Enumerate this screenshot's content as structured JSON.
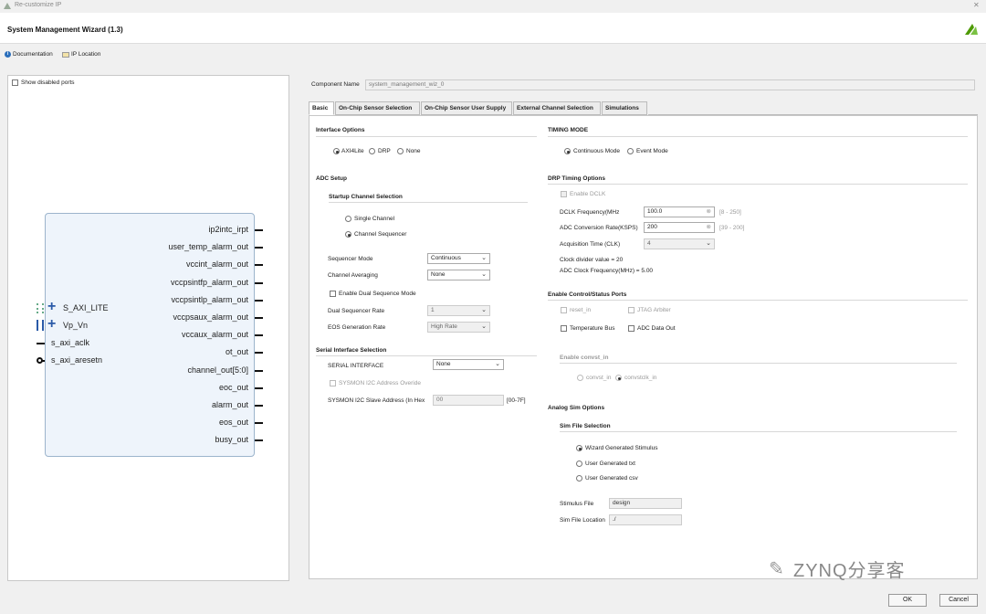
{
  "window": {
    "title": "Re-customize IP",
    "wizard_title": "System Management Wizard (1.3)"
  },
  "links": {
    "documentation": "Documentation",
    "ip_location": "IP Location"
  },
  "left": {
    "show_disabled": "Show disabled ports",
    "outputs": [
      "ip2intc_irpt",
      "user_temp_alarm_out",
      "vccint_alarm_out",
      "vccpsintfp_alarm_out",
      "vccpsintlp_alarm_out",
      "vccpsaux_alarm_out",
      "vccaux_alarm_out",
      "ot_out",
      "channel_out[5:0]",
      "eoc_out",
      "alarm_out",
      "eos_out",
      "busy_out"
    ],
    "inputs": [
      "S_AXI_LITE",
      "Vp_Vn",
      "s_axi_aclk",
      "s_axi_aresetn"
    ]
  },
  "component": {
    "label": "Component Name",
    "value": "system_management_wiz_0"
  },
  "tabs": [
    "Basic",
    "On-Chip Sensor Selection",
    "On-Chip Sensor User Supply",
    "External Channel Selection",
    "Simulations"
  ],
  "basic": {
    "interface_options": "Interface Options",
    "iface": [
      "AXI4Lite",
      "DRP",
      "None"
    ],
    "adc_setup": "ADC Setup",
    "startup": "Startup Channel Selection",
    "single": "Single Channel",
    "sequencer": "Channel Sequencer",
    "seq_mode_l": "Sequencer Mode",
    "seq_mode_v": "Continuous",
    "avg_l": "Channel Averaging",
    "avg_v": "None",
    "dual": "Enable Dual Sequence Mode",
    "dual_rate_l": "Dual Sequencer Rate",
    "dual_rate_v": "1",
    "eos_l": "EOS Generation Rate",
    "eos_v": "High Rate",
    "serial_sec": "Serial Interface Selection",
    "serial_l": "SERIAL INTERFACE",
    "serial_v": "None",
    "i2c_override": "SYSMON I2C Address Overide",
    "i2c_addr_l": "SYSMON I2C Slave Address (In Hex",
    "i2c_addr_v": "00",
    "i2c_addr_r": "[00-7F]",
    "timing_mode": "TIMING MODE",
    "timing": [
      "Continuous Mode",
      "Event Mode"
    ],
    "drp_timing": "DRP Timing Options",
    "dclk_en": "Enable DCLK",
    "dclk_l": "DCLK Frequency(MHz",
    "dclk_v": "100.0",
    "dclk_r": "[8 - 250]",
    "adc_rate_l": "ADC Conversion Rate(KSPS)",
    "adc_rate_v": "200",
    "adc_rate_r": "[39 - 200]",
    "acq_l": "Acquisition Time (CLK)",
    "acq_v": "4",
    "clk_div": "Clock divider value = 20",
    "adc_clk": "ADC Clock Frequency(MHz) = 5.00",
    "ctrl_ports": "Enable Control/Status Ports",
    "reset_in": "reset_in",
    "jtag": "JTAG Arbiter",
    "temp_bus": "Temperature Bus",
    "adc_out": "ADC Data Out",
    "convst": "Enable convst_in",
    "convst_in": "convst_in",
    "convstclk": "convstclk_in",
    "analog_sim": "Analog Sim Options",
    "sim_sel": "Sim File Selection",
    "sim": [
      "Wizard Generated Stimulus",
      "User Generated txt",
      "User Generated csv"
    ],
    "stim_l": "Stimulus File",
    "stim_v": "design",
    "simloc_l": "Sim File Location",
    "simloc_v": "./"
  },
  "buttons": {
    "ok": "OK",
    "cancel": "Cancel"
  },
  "watermark": "ZYNQ分享客",
  "colors": {
    "block_fill": "#eef4fb",
    "block_border": "#9cb4cc",
    "logo": "#4e9a06"
  }
}
